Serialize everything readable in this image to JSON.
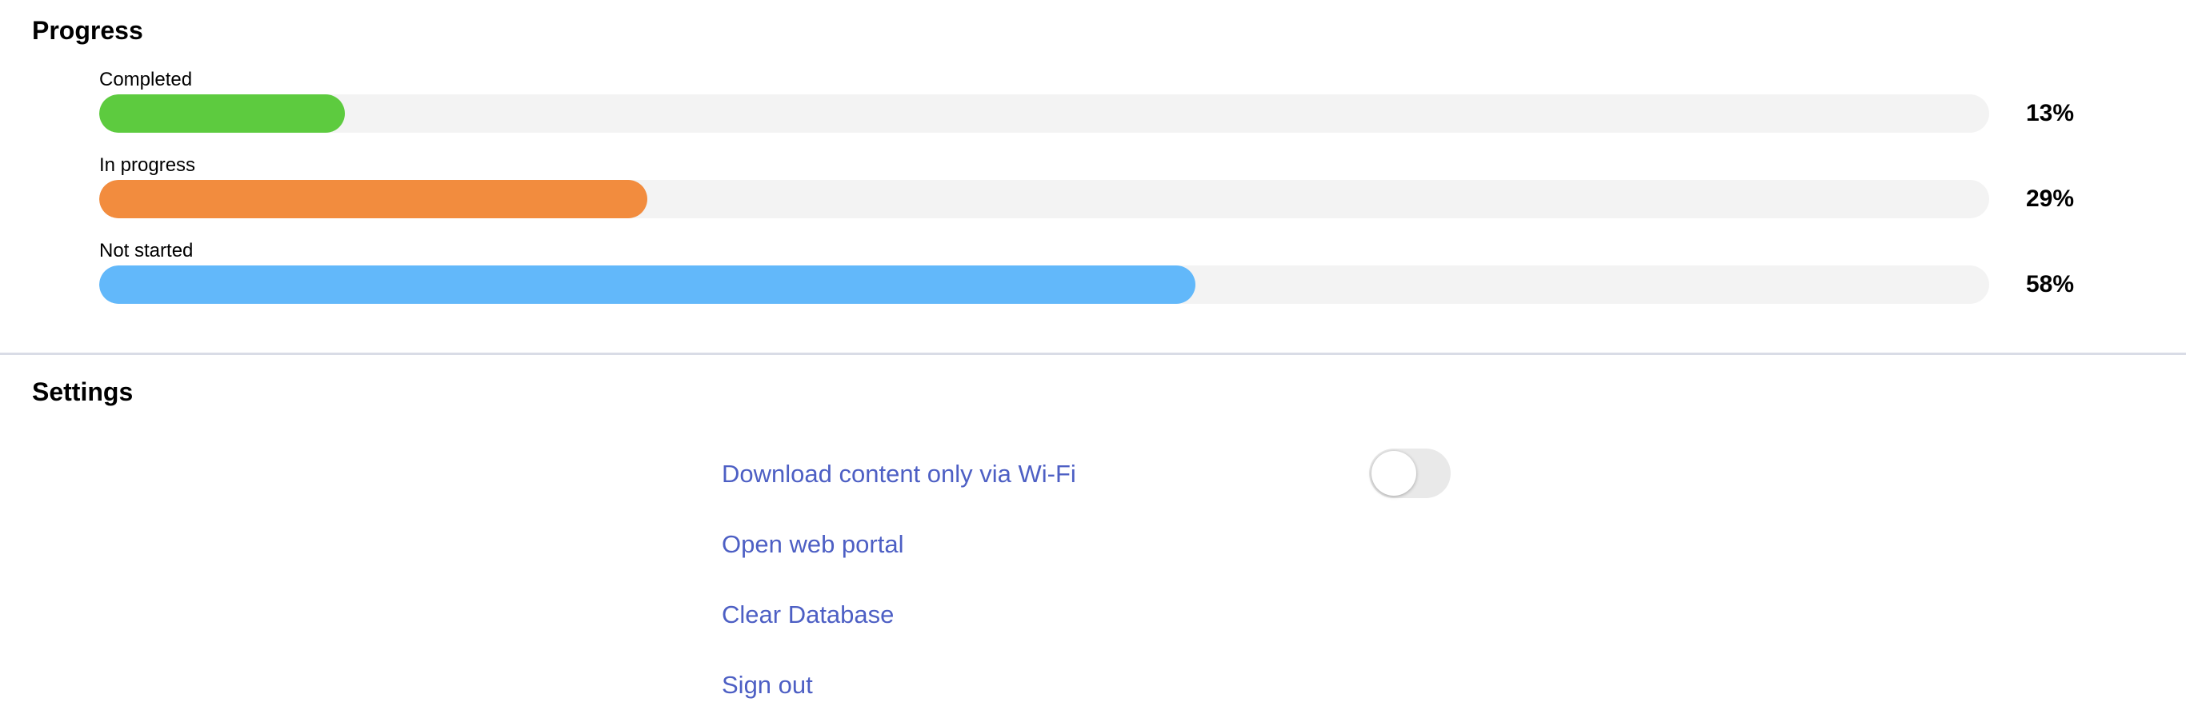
{
  "progress": {
    "title": "Progress",
    "items": [
      {
        "label": "Completed",
        "percent_text": "13%",
        "value": 0.13,
        "color": "#5dcb3f"
      },
      {
        "label": "In progress",
        "percent_text": "29%",
        "value": 0.29,
        "color": "#f28c3e"
      },
      {
        "label": "Not started",
        "percent_text": "58%",
        "value": 0.58,
        "color": "#62b8fa"
      }
    ],
    "track_color": "#f3f3f3"
  },
  "settings": {
    "title": "Settings",
    "wifi_only": {
      "label": "Download content only via Wi-Fi",
      "enabled": false
    },
    "open_portal": {
      "label": "Open web portal"
    },
    "clear_database": {
      "label": "Clear Database"
    },
    "sign_out": {
      "label": "Sign out"
    },
    "link_color": "#4d5fc4"
  }
}
